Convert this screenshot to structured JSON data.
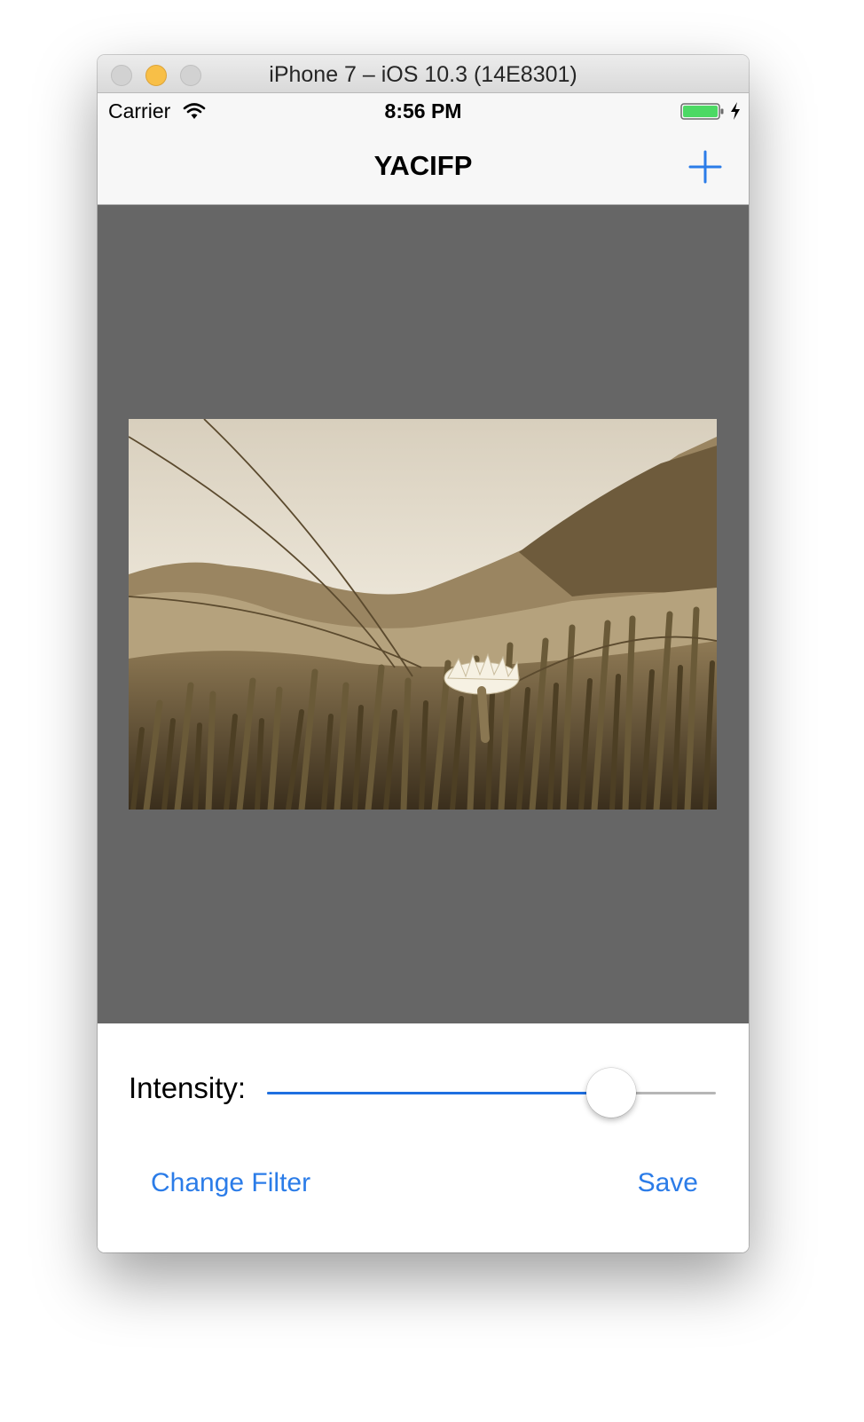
{
  "window": {
    "title": "iPhone 7 – iOS 10.3 (14E8301)"
  },
  "status_bar": {
    "carrier": "Carrier",
    "time": "8:56 PM",
    "battery_color": "#4cd964"
  },
  "nav_bar": {
    "title": "YACIFP",
    "add_icon": "plus-icon"
  },
  "colors": {
    "tint": "#2b7ce8",
    "image_background": "#666666"
  },
  "controls": {
    "intensity_label": "Intensity:",
    "intensity_value": 0.8,
    "change_filter_label": "Change Filter",
    "save_label": "Save"
  }
}
